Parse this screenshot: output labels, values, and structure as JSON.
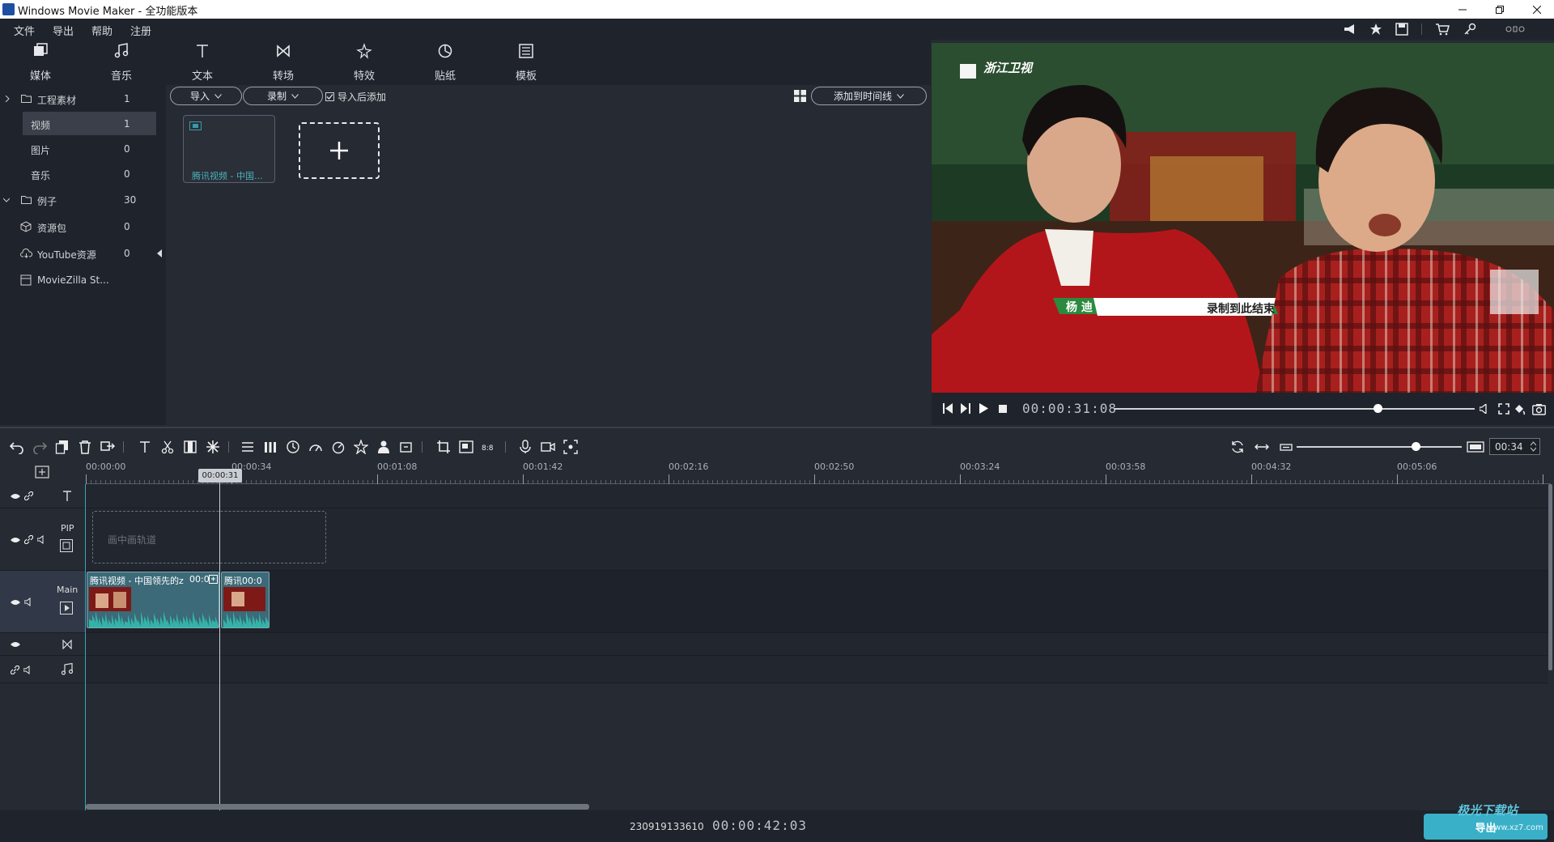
{
  "window": {
    "title": "Windows Movie Maker - 全功能版本"
  },
  "menu": [
    "文件",
    "导出",
    "帮助",
    "注册"
  ],
  "toolbar": [
    {
      "label": "媒体",
      "icon": "media-icon"
    },
    {
      "label": "音乐",
      "icon": "music-note-icon"
    },
    {
      "label": "文本",
      "icon": "text-icon"
    },
    {
      "label": "转场",
      "icon": "transition-icon"
    },
    {
      "label": "特效",
      "icon": "effects-icon"
    },
    {
      "label": "贴纸",
      "icon": "sticker-icon"
    },
    {
      "label": "模板",
      "icon": "template-icon"
    }
  ],
  "tree": [
    {
      "label": "工程素材",
      "count": "1"
    },
    {
      "label": "视频",
      "count": "1",
      "selected": true
    },
    {
      "label": "图片",
      "count": "0"
    },
    {
      "label": "音乐",
      "count": "0"
    },
    {
      "label": "例子",
      "count": "30"
    },
    {
      "label": "资源包",
      "count": "0"
    },
    {
      "label": "YouTube资源",
      "count": "0"
    },
    {
      "label": "MovieZilla St...",
      "count": ""
    }
  ],
  "media": {
    "import_label": "导入",
    "record_label": "录制",
    "add_after_import": "导入后添加",
    "add_to_timeline": "添加到时间线",
    "clip_name": "腾讯视频 - 中国..."
  },
  "preview": {
    "channel_logo": "浙江卫视",
    "caption_name": "杨 迪",
    "caption_text": "录制到此结束",
    "time": "00:00:31:08",
    "progress": 0.73
  },
  "timeline": {
    "zoom_value": "00:34",
    "zoom_level": 0.72,
    "playhead_label": "00:00:31",
    "ruler": [
      "00:00:00",
      "00:00:34",
      "00:01:08",
      "00:01:42",
      "00:02:16",
      "00:02:50",
      "00:03:24",
      "00:03:58",
      "00:04:32",
      "00:05:06"
    ],
    "pip_label": "PIP",
    "pip_placeholder": "画中画轨道",
    "main_label": "Main",
    "clip1_title": "腾讯视频 - 中国领先的z",
    "clip1_time": "00:0",
    "clip2_title": "腾讯00:0"
  },
  "status": {
    "code": "230919133610",
    "duration": "00:00:42:03",
    "export_label": "导出",
    "watermark": "极光下载站",
    "watermark_url": "www.xz7.com"
  }
}
